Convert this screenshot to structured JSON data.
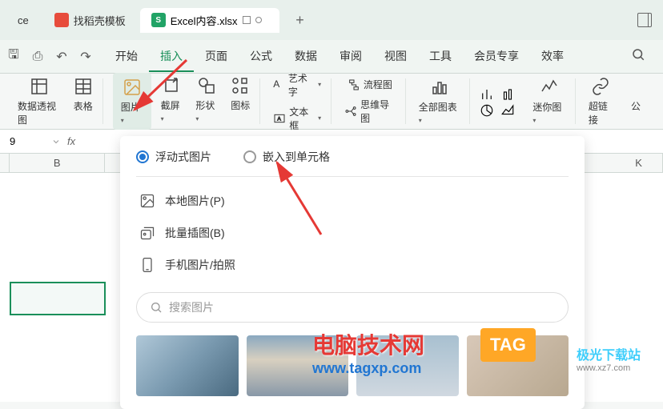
{
  "tabs": {
    "find_template": "找稻壳模板",
    "active_file": "Excel内容.xlsx",
    "left_partial": "ce"
  },
  "menu": {
    "start": "开始",
    "insert": "插入",
    "page": "页面",
    "formula": "公式",
    "data": "数据",
    "review": "审阅",
    "view": "视图",
    "tools": "工具",
    "member": "会员专享",
    "efficiency": "效率"
  },
  "ribbon": {
    "pivot_table": "数据透视图",
    "table": "表格",
    "picture": "图片",
    "screenshot": "截屏",
    "shapes": "形状",
    "icons": "图标",
    "wordart": "艺术字",
    "textbox": "文本框",
    "flowchart": "流程图",
    "mindmap": "思维导图",
    "all_charts": "全部图表",
    "sparkline": "迷你图",
    "hyperlink": "超链接",
    "partial": "公"
  },
  "formula_bar": {
    "cell": "9",
    "fx": "fx"
  },
  "columns": {
    "b": "B",
    "k": "K"
  },
  "panel": {
    "floating_image": "浮动式图片",
    "embed_cell": "嵌入到单元格",
    "local_image": "本地图片(P)",
    "batch_insert": "批量插图(B)",
    "phone_image": "手机图片/拍照",
    "search_placeholder": "搜索图片"
  },
  "watermarks": {
    "site1_name": "电脑技术网",
    "site1_url": "www.tagxp.com",
    "tag_label": "TAG",
    "site2_name": "极光下载站",
    "site2_url": "www.xz7.com"
  }
}
